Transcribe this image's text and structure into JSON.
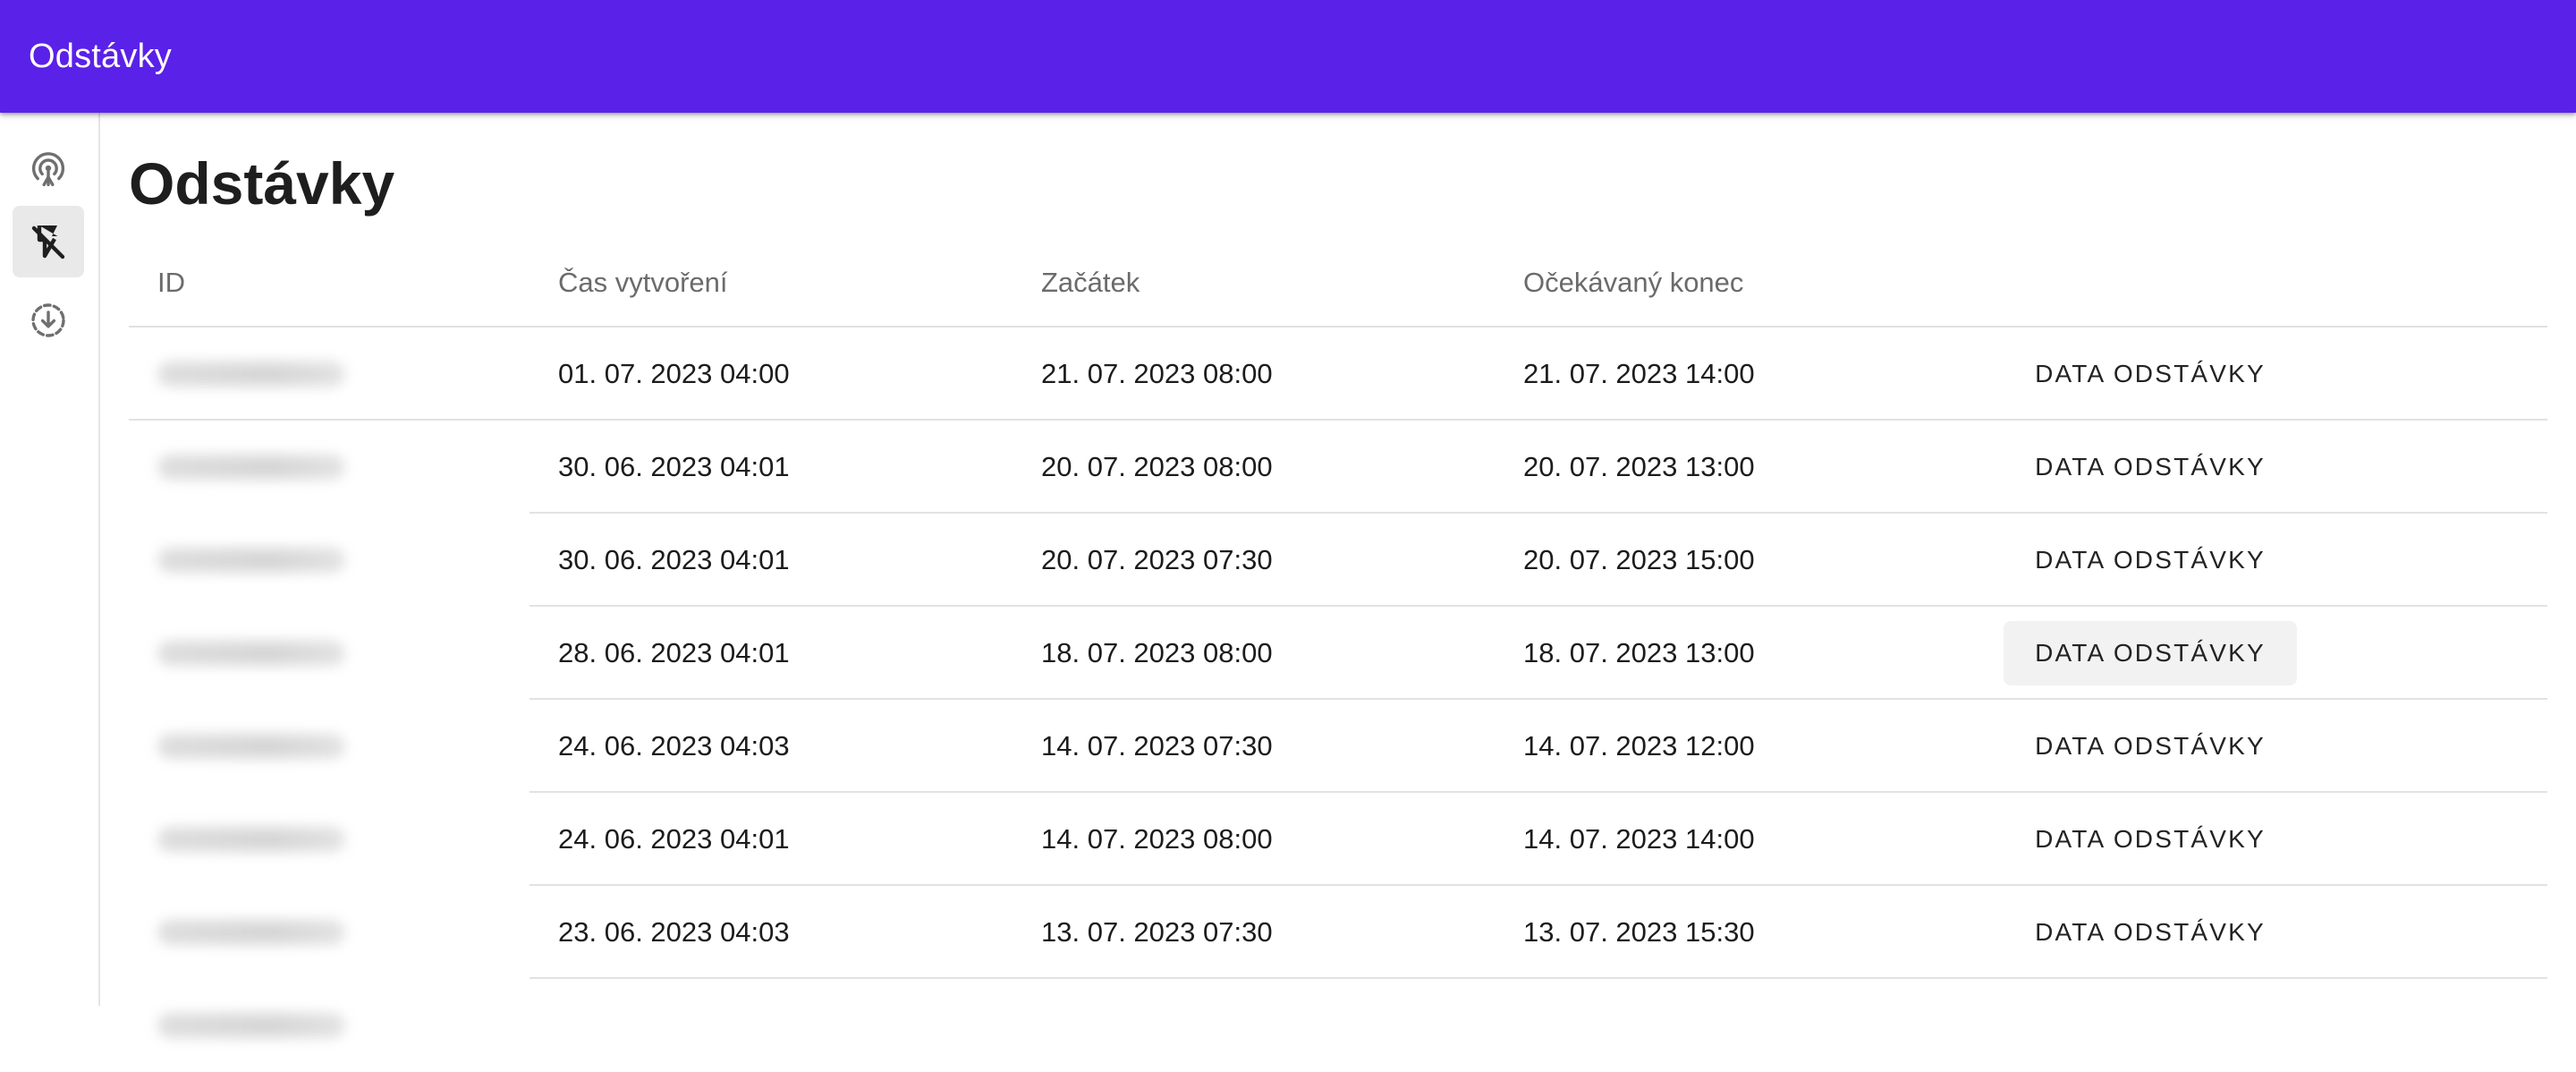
{
  "app": {
    "title": "Odstávky"
  },
  "sidebar": {
    "items": [
      {
        "icon": "antenna-signal-icon",
        "active": false
      },
      {
        "icon": "flash-off-icon",
        "active": true
      },
      {
        "icon": "download-circle-icon",
        "active": false
      }
    ]
  },
  "main": {
    "title": "Odstávky",
    "table": {
      "headers": {
        "id": "ID",
        "created": "Čas vytvoření",
        "start": "Začátek",
        "end": "Očekávaný konec"
      },
      "action_label": "DATA ODSTÁVKY",
      "rows": [
        {
          "created": "01. 07. 2023 04:00",
          "start": "21. 07. 2023 08:00",
          "end": "21. 07. 2023 14:00"
        },
        {
          "created": "30. 06. 2023 04:01",
          "start": "20. 07. 2023 08:00",
          "end": "20. 07. 2023 13:00"
        },
        {
          "created": "30. 06. 2023 04:01",
          "start": "20. 07. 2023 07:30",
          "end": "20. 07. 2023 15:00"
        },
        {
          "created": "28. 06. 2023 04:01",
          "start": "18. 07. 2023 08:00",
          "end": "18. 07. 2023 13:00"
        },
        {
          "created": "24. 06. 2023 04:03",
          "start": "14. 07. 2023 07:30",
          "end": "14. 07. 2023 12:00"
        },
        {
          "created": "24. 06. 2023 04:01",
          "start": "14. 07. 2023 08:00",
          "end": "14. 07. 2023 14:00"
        },
        {
          "created": "23. 06. 2023 04:03",
          "start": "13. 07. 2023 07:30",
          "end": "13. 07. 2023 15:30"
        }
      ]
    }
  },
  "colors": {
    "appbar": "#5a21e8",
    "active_nav": "#e9e9e9"
  }
}
